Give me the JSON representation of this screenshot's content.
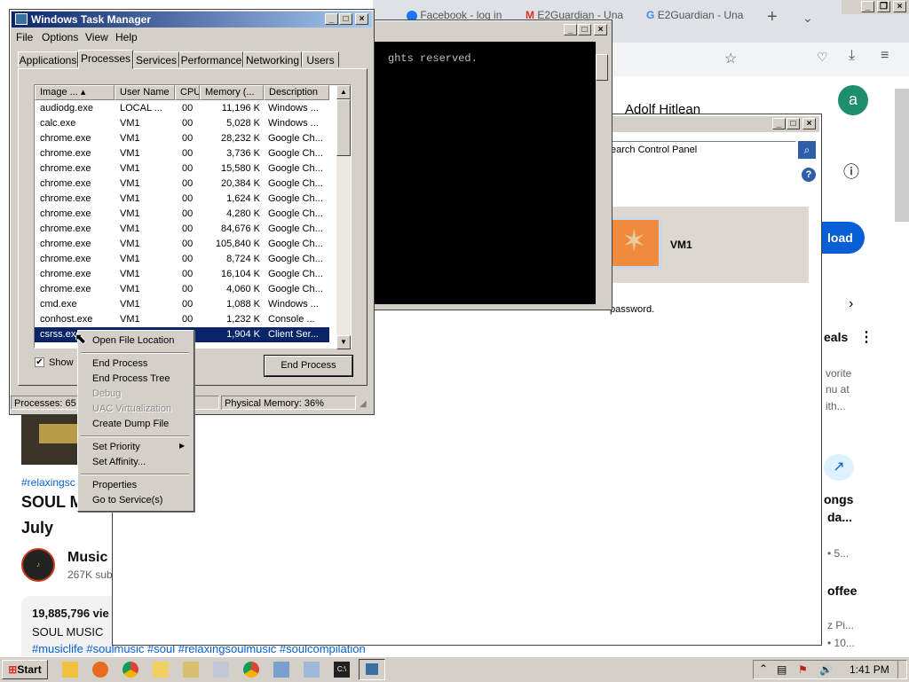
{
  "browser": {
    "tabs": [
      "Facebook - log in",
      "E2Guardian - Una",
      "E2Guardian - Una"
    ],
    "new_tab": "+",
    "channel_title": "Adolf Hitlean",
    "avatar_letter": "a",
    "download_label": "load",
    "side_texts": [
      "eals",
      "vorite",
      "nu at",
      "ith...",
      "ongs",
      "da...",
      "• 5...",
      "offee",
      "z Pi...",
      "• 10..."
    ],
    "video_tags": "#relaxingsc",
    "video_title_line1": "SOUL M",
    "video_title_line2": "July",
    "channel_name": "Music",
    "subs": "267K sub",
    "views": "19,885,796 vie",
    "desc_title": "SOUL MUSIC",
    "hashtags": "#musiclife #soulmusic #soul  #relaxingsoulmusic #soulcompilation"
  },
  "cmd": {
    "text": "ghts reserved.",
    "below_text": "password."
  },
  "control_panel": {
    "search_placeholder": "earch Control Panel",
    "user": "VM1"
  },
  "taskmgr": {
    "title": "Windows Task Manager",
    "menu": [
      "File",
      "Options",
      "View",
      "Help"
    ],
    "tabs": [
      "Applications",
      "Processes",
      "Services",
      "Performance",
      "Networking",
      "Users"
    ],
    "selected_tab": "Processes",
    "columns": [
      "Image ...",
      "User Name",
      "CPU",
      "Memory (...",
      "Description"
    ],
    "rows": [
      [
        "audiodg.exe",
        "LOCAL ...",
        "00",
        "11,196 K",
        "Windows ..."
      ],
      [
        "calc.exe",
        "VM1",
        "00",
        "5,028 K",
        "Windows ..."
      ],
      [
        "chrome.exe",
        "VM1",
        "00",
        "28,232 K",
        "Google Ch..."
      ],
      [
        "chrome.exe",
        "VM1",
        "00",
        "3,736 K",
        "Google Ch..."
      ],
      [
        "chrome.exe",
        "VM1",
        "00",
        "15,580 K",
        "Google Ch..."
      ],
      [
        "chrome.exe",
        "VM1",
        "00",
        "20,384 K",
        "Google Ch..."
      ],
      [
        "chrome.exe",
        "VM1",
        "00",
        "1,624 K",
        "Google Ch..."
      ],
      [
        "chrome.exe",
        "VM1",
        "00",
        "4,280 K",
        "Google Ch..."
      ],
      [
        "chrome.exe",
        "VM1",
        "00",
        "84,676 K",
        "Google Ch..."
      ],
      [
        "chrome.exe",
        "VM1",
        "00",
        "105,840 K",
        "Google Ch..."
      ],
      [
        "chrome.exe",
        "VM1",
        "00",
        "8,724 K",
        "Google Ch..."
      ],
      [
        "chrome.exe",
        "VM1",
        "00",
        "16,104 K",
        "Google Ch..."
      ],
      [
        "chrome.exe",
        "VM1",
        "00",
        "4,060 K",
        "Google Ch..."
      ],
      [
        "cmd.exe",
        "VM1",
        "00",
        "1,088 K",
        "Windows ..."
      ],
      [
        "conhost.exe",
        "VM1",
        "00",
        "1,232 K",
        "Console ..."
      ],
      [
        "csrss.exe",
        "",
        "",
        "1,904 K",
        "Client Ser..."
      ]
    ],
    "selected_row": 15,
    "show_label": "Show",
    "end_process": "End Process",
    "status_processes": "Processes: 65",
    "status_memory": "Physical Memory: 36%"
  },
  "context_menu": {
    "items": [
      "Open File Location",
      "End Process",
      "End Process Tree",
      "Debug",
      "UAC Virtualization",
      "Create Dump File",
      "Set Priority",
      "Set Affinity...",
      "Properties",
      "Go to Service(s)"
    ]
  },
  "taskbar": {
    "start": "Start",
    "clock": "1:41 PM"
  },
  "colors": {
    "title_active": "#0a246a",
    "youtube_blue": "#065fd4",
    "selection": "#0a246a"
  }
}
